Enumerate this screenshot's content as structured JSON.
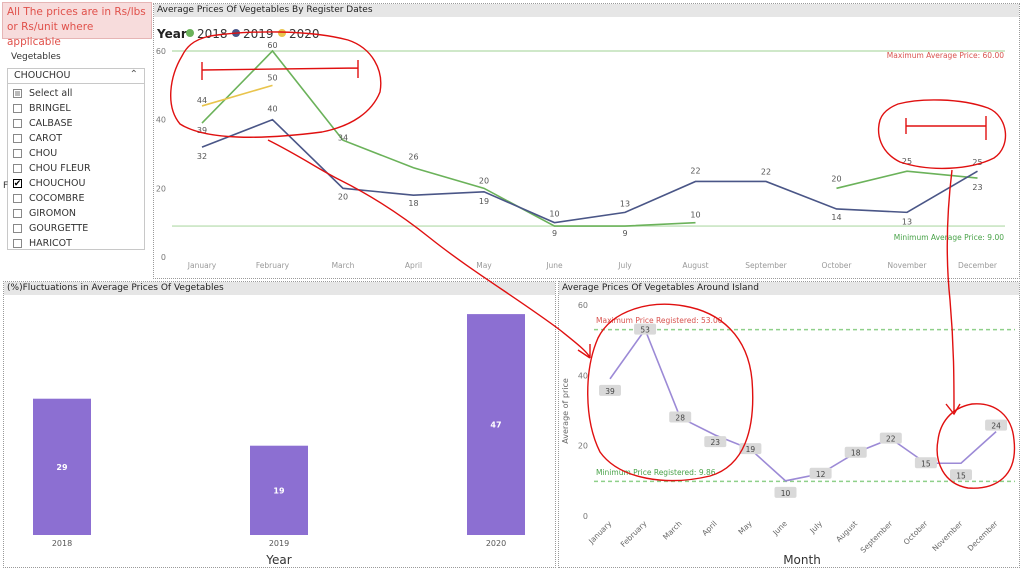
{
  "note": {
    "line1": "All The prices are in  Rs/lbs",
    "line2": "or Rs/unit where applicable"
  },
  "slicer": {
    "title": "Vegetables",
    "selected": "CHOUCHOU",
    "items": [
      {
        "label": "Select all",
        "checked": false,
        "partial": true
      },
      {
        "label": "BRINGEL",
        "checked": false
      },
      {
        "label": "CALBASE",
        "checked": false
      },
      {
        "label": "CAROT",
        "checked": false
      },
      {
        "label": "CHOU",
        "checked": false
      },
      {
        "label": "CHOU FLEUR",
        "checked": false
      },
      {
        "label": "CHOUCHOU",
        "checked": true
      },
      {
        "label": "COCOMBRE",
        "checked": false
      },
      {
        "label": "GIROMON",
        "checked": false
      },
      {
        "label": "GOURGETTE",
        "checked": false
      },
      {
        "label": "HARICOT",
        "checked": false
      }
    ]
  },
  "line_chart": {
    "header": "Average Prices Of Vegetables By Register Dates",
    "legend_title": "Year",
    "ref_max_label": "Maximum Average Price: 60.00",
    "ref_min_label": "Minimum Average Price: 9.00",
    "side_label": "F"
  },
  "bar_chart": {
    "header": "(%)Fluctuations in Average Prices Of Vegetables"
  },
  "area_chart": {
    "header": "Average Prices Of Vegetables Around Island",
    "ref_max_label": "Maximum Price Registered: 53.00",
    "ref_min_label": "Minimum Price Registered: 9.86"
  },
  "colors": {
    "s2018": "#6bb25a",
    "s2019": "#4a5687",
    "s2020": "#e9c44c",
    "bar": "#8c6fd2",
    "line": "#9c8ad6",
    "annot": "#e01010"
  },
  "chart_data": [
    {
      "type": "line",
      "title": "Average Prices Of Vegetables By Register Dates",
      "categories": [
        "January",
        "February",
        "March",
        "April",
        "May",
        "June",
        "July",
        "August",
        "September",
        "October",
        "November",
        "December"
      ],
      "ylim": [
        0,
        60
      ],
      "yticks": [
        0,
        20,
        40,
        60
      ],
      "legend_title": "Year",
      "legend": "top-left",
      "series": [
        {
          "name": "2018",
          "values": [
            39,
            60,
            34,
            26,
            20,
            9,
            9,
            10,
            null,
            20,
            25,
            23
          ],
          "labels": [
            "39",
            "60",
            "34",
            "26",
            "20",
            "9",
            "9",
            "10",
            "",
            "20",
            "25",
            "23"
          ]
        },
        {
          "name": "2019",
          "values": [
            32,
            40,
            20,
            18,
            19,
            10,
            13,
            22,
            22,
            14,
            13,
            25
          ],
          "labels": [
            "32",
            "40",
            "20",
            "18",
            "19",
            "10",
            "13",
            "22",
            "22",
            "14",
            "13",
            "25"
          ]
        },
        {
          "name": "2020",
          "values": [
            44,
            50,
            null,
            null,
            null,
            null,
            null,
            null,
            null,
            null,
            null,
            null
          ],
          "labels": [
            "44",
            "50",
            "",
            "",
            "",
            "",
            "",
            "",
            "",
            "",
            "",
            ""
          ]
        }
      ]
    },
    {
      "type": "bar",
      "title": "(%)Fluctuations in Average Prices Of Vegetables",
      "categories": [
        "2018",
        "2019",
        "2020"
      ],
      "values": [
        29,
        19,
        47
      ],
      "xlabel": "Year"
    },
    {
      "type": "line",
      "title": "Average Prices Of Vegetables Around Island",
      "categories": [
        "January",
        "February",
        "March",
        "April",
        "May",
        "June",
        "July",
        "August",
        "September",
        "October",
        "November",
        "December"
      ],
      "values": [
        39,
        53,
        28,
        23,
        19,
        10,
        12,
        18,
        22,
        15,
        15,
        24
      ],
      "labels": [
        "39",
        "53",
        "28",
        "23",
        "19",
        "10",
        "12",
        "18",
        "22",
        "15",
        "15",
        "24"
      ],
      "xlabel": "Month",
      "ylabel": "Average of price",
      "ylim": [
        0,
        60
      ],
      "yticks": [
        0,
        20,
        40,
        60
      ]
    }
  ]
}
